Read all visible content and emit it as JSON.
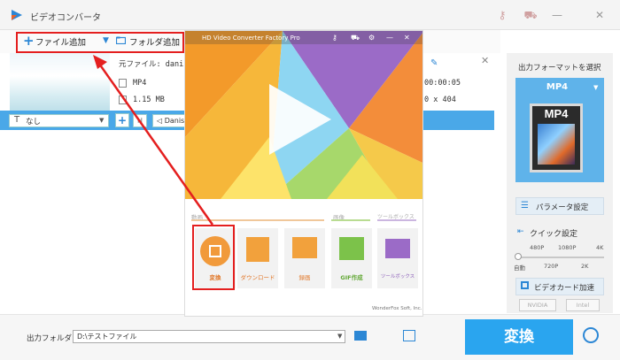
{
  "window": {
    "title": "ビデオコンバータ"
  },
  "toolbar": {
    "add_file": "ファイル追加",
    "add_folder": "フォルダ追加"
  },
  "file": {
    "source_label": "元ファイル: danis",
    "format": "MP4",
    "size": "1.15 MB",
    "duration": "00:00:05",
    "resolution": "0 x 404"
  },
  "edit_bar": {
    "subtitle_option": "なし",
    "audio_option": "Danis"
  },
  "right_panel": {
    "output_format_title": "出力フォーマットを選択",
    "format_name": "MP4",
    "format_badge": "MP4",
    "param_button": "パラメータ設定",
    "quick_label": "クイック設定",
    "quick_ticks_top": [
      "480P",
      "1080P",
      "4K"
    ],
    "quick_ticks_bottom": [
      "自動",
      "720P",
      "2K"
    ],
    "quick_level": 0,
    "gpu_button": "ビデオカード加速",
    "gpu_chips": [
      "NVIDIA",
      "Intel"
    ]
  },
  "bottom": {
    "output_folder_label": "出力フォルダ:",
    "output_folder_value": "D:\\テストファイル",
    "convert_button": "変換"
  },
  "overlay": {
    "title": "HD Video Converter Factory Pro",
    "section_labels": [
      "動画",
      "画像",
      "ツールボックス"
    ],
    "tiles": [
      "変換",
      "ダウンロード",
      "録画",
      "GIF作成",
      "ツールボックス"
    ],
    "footer": "WonderFox Soft, Inc."
  },
  "colors": {
    "accent": "#2c87d5",
    "highlight_red": "#e41f1f",
    "convert_blue": "#2aa5ef"
  }
}
